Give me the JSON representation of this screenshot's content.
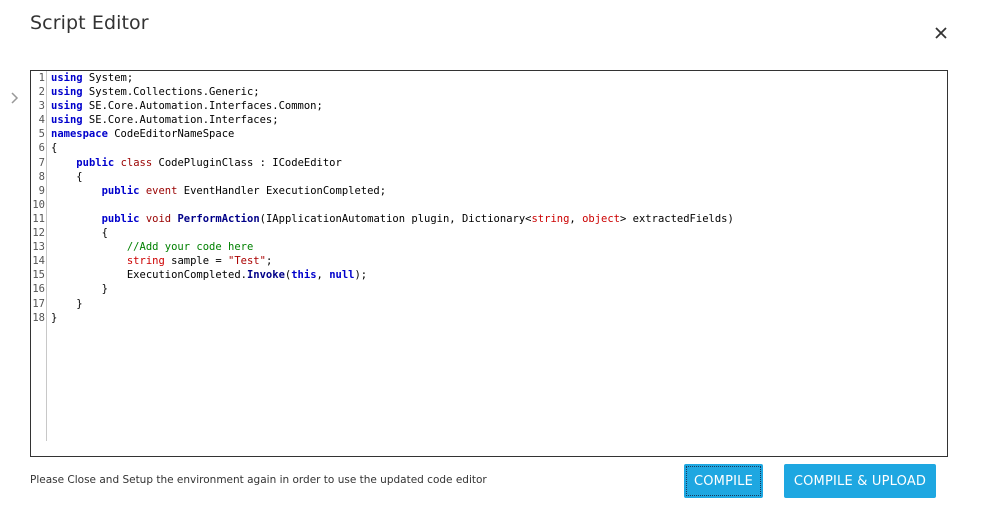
{
  "dialog": {
    "title": "Script Editor",
    "close_icon": "close-icon",
    "side_icon": "chevron-right-icon"
  },
  "editor": {
    "lines": [
      {
        "n": "1",
        "tokens": [
          {
            "t": "kw",
            "v": "using"
          },
          {
            "t": "",
            "v": " System;"
          }
        ]
      },
      {
        "n": "2",
        "tokens": [
          {
            "t": "kw",
            "v": "using"
          },
          {
            "t": "",
            "v": " System.Collections.Generic;"
          }
        ]
      },
      {
        "n": "3",
        "tokens": [
          {
            "t": "kw",
            "v": "using"
          },
          {
            "t": "",
            "v": " SE.Core.Automation.Interfaces.Common;"
          }
        ]
      },
      {
        "n": "4",
        "tokens": [
          {
            "t": "kw",
            "v": "using"
          },
          {
            "t": "",
            "v": " SE.Core.Automation.Interfaces;"
          }
        ]
      },
      {
        "n": "5",
        "tokens": [
          {
            "t": "kw",
            "v": "namespace"
          },
          {
            "t": "",
            "v": " CodeEditorNameSpace"
          }
        ]
      },
      {
        "n": "6",
        "tokens": [
          {
            "t": "",
            "v": "{"
          }
        ]
      },
      {
        "n": "7",
        "tokens": [
          {
            "t": "",
            "v": "    "
          },
          {
            "t": "kw",
            "v": "public"
          },
          {
            "t": "",
            "v": " "
          },
          {
            "t": "kw2",
            "v": "class"
          },
          {
            "t": "",
            "v": " CodePluginClass : ICodeEditor"
          }
        ]
      },
      {
        "n": "8",
        "tokens": [
          {
            "t": "",
            "v": "    {"
          }
        ]
      },
      {
        "n": "9",
        "tokens": [
          {
            "t": "",
            "v": "        "
          },
          {
            "t": "kw",
            "v": "public"
          },
          {
            "t": "",
            "v": " "
          },
          {
            "t": "kw2",
            "v": "event"
          },
          {
            "t": "",
            "v": " EventHandler ExecutionCompleted;"
          }
        ]
      },
      {
        "n": "10",
        "tokens": [
          {
            "t": "",
            "v": ""
          }
        ]
      },
      {
        "n": "11",
        "tokens": [
          {
            "t": "",
            "v": "        "
          },
          {
            "t": "kw",
            "v": "public"
          },
          {
            "t": "",
            "v": " "
          },
          {
            "t": "kw2",
            "v": "void"
          },
          {
            "t": "",
            "v": " "
          },
          {
            "t": "fn",
            "v": "PerformAction"
          },
          {
            "t": "",
            "v": "(IApplicationAutomation plugin, Dictionary<"
          },
          {
            "t": "typ",
            "v": "string"
          },
          {
            "t": "",
            "v": ", "
          },
          {
            "t": "typ",
            "v": "object"
          },
          {
            "t": "",
            "v": "> extractedFields)"
          }
        ]
      },
      {
        "n": "12",
        "tokens": [
          {
            "t": "",
            "v": "        {"
          }
        ]
      },
      {
        "n": "13",
        "tokens": [
          {
            "t": "",
            "v": "            "
          },
          {
            "t": "cmt",
            "v": "//Add your code here"
          }
        ]
      },
      {
        "n": "14",
        "tokens": [
          {
            "t": "",
            "v": "            "
          },
          {
            "t": "typ",
            "v": "string"
          },
          {
            "t": "",
            "v": " sample = "
          },
          {
            "t": "str",
            "v": "\"Test\""
          },
          {
            "t": "",
            "v": ";"
          }
        ]
      },
      {
        "n": "15",
        "tokens": [
          {
            "t": "",
            "v": "            ExecutionCompleted."
          },
          {
            "t": "fn",
            "v": "Invoke"
          },
          {
            "t": "",
            "v": "("
          },
          {
            "t": "kw",
            "v": "this"
          },
          {
            "t": "",
            "v": ", "
          },
          {
            "t": "kw",
            "v": "null"
          },
          {
            "t": "",
            "v": ");"
          }
        ]
      },
      {
        "n": "16",
        "tokens": [
          {
            "t": "",
            "v": "        }"
          }
        ]
      },
      {
        "n": "17",
        "tokens": [
          {
            "t": "",
            "v": "    }"
          }
        ]
      },
      {
        "n": "18",
        "tokens": [
          {
            "t": "",
            "v": "}"
          }
        ]
      }
    ]
  },
  "footer": {
    "note": "Please Close and Setup the environment again in order to use the updated code editor",
    "compile_label": "COMPILE",
    "upload_label": "COMPILE & UPLOAD",
    "button_color": "#1ea7e1"
  }
}
